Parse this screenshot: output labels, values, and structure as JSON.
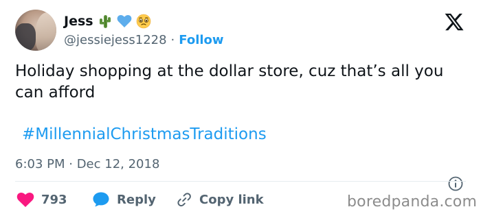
{
  "author": {
    "display_name": "Jess",
    "handle": "@jessiejess1228",
    "separator": "·",
    "follow_label": "Follow",
    "emojis": [
      "cactus",
      "blue-heart",
      "pleading-face"
    ]
  },
  "tweet": {
    "text": "Holiday shopping at the dollar store, cuz that’s all you can afford",
    "hashtag": "#MillennialChristmasTraditions",
    "timestamp": "6:03 PM · Dec 12, 2018"
  },
  "actions": {
    "like_count": "793",
    "reply_label": "Reply",
    "copy_link_label": "Copy link"
  },
  "watermark": "boredpanda.com",
  "colors": {
    "accent": "#1d9bf0",
    "like": "#f91880",
    "text": "#0f1419",
    "muted": "#536471"
  }
}
